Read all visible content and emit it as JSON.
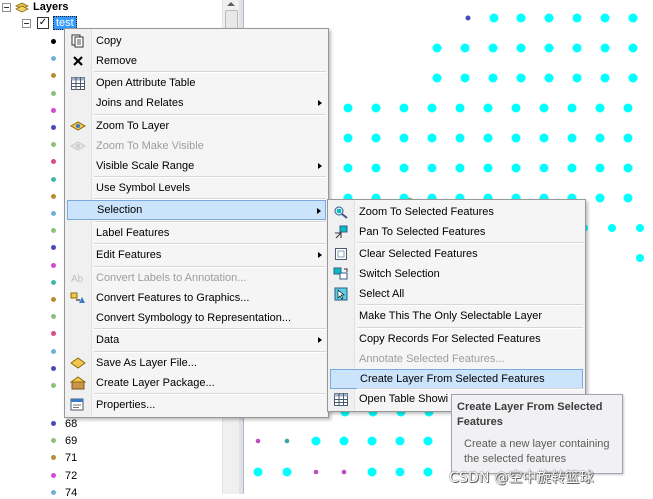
{
  "toc": {
    "root_label": "Layers",
    "layer_label": "test",
    "layer_checked": true,
    "legend_items": [
      {
        "label": "68",
        "color": "#4a4bb8"
      },
      {
        "label": "69",
        "color": "#8ec07c"
      },
      {
        "label": "71",
        "color": "#b88d3a"
      },
      {
        "label": "72",
        "color": "#d24bd2"
      },
      {
        "label": "74",
        "color": "#6fb3d2"
      }
    ],
    "hidden_dot_colors": [
      "#000000",
      "#6fb3d2",
      "#b88d3a",
      "#8ec07c",
      "#d24bd2",
      "#4a4bb8",
      "#8ec07c",
      "#d94b8a",
      "#3fb8a8",
      "#b88d3a",
      "#6fb3d2",
      "#8ec07c",
      "#4a4bb8",
      "#d24bd2",
      "#3fb8a8",
      "#b88d3a",
      "#8ec07c",
      "#d94b8a",
      "#6fb3d2",
      "#4a4bb8",
      "#8ec07c"
    ]
  },
  "context_menu": {
    "items": [
      {
        "label": "Copy",
        "icon": "copy-icon",
        "enabled": true
      },
      {
        "label": "Remove",
        "icon": "remove-icon",
        "enabled": true
      },
      {
        "label": "Open Attribute Table",
        "icon": "table-icon",
        "enabled": true
      },
      {
        "label": "Joins and Relates",
        "submenu": true,
        "enabled": true
      },
      {
        "label": "Zoom To Layer",
        "icon": "zoom-layer-icon",
        "enabled": true
      },
      {
        "label": "Zoom To Make Visible",
        "icon": "zoom-visible-icon",
        "enabled": false
      },
      {
        "label": "Visible Scale Range",
        "submenu": true,
        "enabled": true
      },
      {
        "label": "Use Symbol Levels",
        "enabled": true
      },
      {
        "label": "Selection",
        "submenu": true,
        "enabled": true,
        "highlighted": true
      },
      {
        "label": "Label Features",
        "enabled": true
      },
      {
        "label": "Edit Features",
        "submenu": true,
        "enabled": true
      },
      {
        "label": "Convert Labels to Annotation...",
        "icon": "convert-labels-icon",
        "enabled": false
      },
      {
        "label": "Convert Features to Graphics...",
        "icon": "convert-graphics-icon",
        "enabled": true
      },
      {
        "label": "Convert Symbology to Representation...",
        "enabled": true
      },
      {
        "label": "Data",
        "submenu": true,
        "enabled": true
      },
      {
        "label": "Save As Layer File...",
        "icon": "layer-file-icon",
        "enabled": true
      },
      {
        "label": "Create Layer Package...",
        "icon": "layer-package-icon",
        "enabled": true
      },
      {
        "label": "Properties...",
        "icon": "properties-icon",
        "enabled": true
      }
    ]
  },
  "selection_menu": {
    "items": [
      {
        "label": "Zoom To Selected Features",
        "icon": "zoom-selected-icon",
        "enabled": true
      },
      {
        "label": "Pan To Selected Features",
        "icon": "pan-selected-icon",
        "enabled": true
      },
      {
        "label": "Clear Selected Features",
        "icon": "clear-selection-icon",
        "enabled": true
      },
      {
        "label": "Switch Selection",
        "icon": "switch-selection-icon",
        "enabled": true
      },
      {
        "label": "Select All",
        "icon": "select-all-icon",
        "enabled": true
      },
      {
        "label": "Make This The Only Selectable Layer",
        "enabled": true
      },
      {
        "label": "Copy Records For Selected Features",
        "enabled": true
      },
      {
        "label": "Annotate Selected Features...",
        "enabled": false
      },
      {
        "label": "Create Layer From Selected Features",
        "enabled": true,
        "highlighted": true
      },
      {
        "label": "Open Table Showing Selected Features",
        "visible_text": "Open Table Showi",
        "icon": "table-icon",
        "enabled": true
      }
    ]
  },
  "tooltip": {
    "title": "Create Layer From Selected Features",
    "body": "Create a new layer containing the selected features"
  },
  "watermark": "CSDN @空中旋转篮球",
  "colors": {
    "highlight_bg": "#cce4fb",
    "highlight_border": "#7aa9de",
    "point_cyan": "#00ffff",
    "point_navy": "#4a4bb8",
    "point_brown": "#b8703a",
    "point_magenta": "#c04bc0",
    "point_teal": "#3fa0a0",
    "point_green": "#7bc07b"
  }
}
